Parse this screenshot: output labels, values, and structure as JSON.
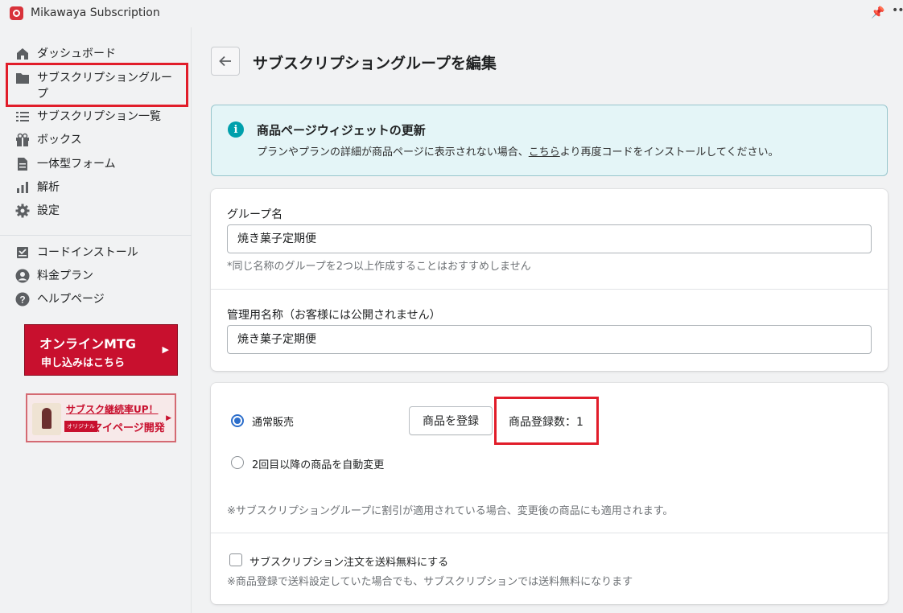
{
  "window": {
    "title": "Mikawaya Subscription"
  },
  "sidebar": {
    "items": [
      {
        "label": "ダッシュボード",
        "icon": "home-icon"
      },
      {
        "label": "サブスクリプショングループ",
        "icon": "folder-icon"
      },
      {
        "label": "サブスクリプション一覧",
        "icon": "list-icon"
      },
      {
        "label": "ボックス",
        "icon": "gift-icon"
      },
      {
        "label": "一体型フォーム",
        "icon": "document-icon"
      },
      {
        "label": "解析",
        "icon": "bar-chart-icon"
      },
      {
        "label": "設定",
        "icon": "gear-icon"
      }
    ],
    "secondary_items": [
      {
        "label": "コードインストール",
        "icon": "install-icon"
      },
      {
        "label": "料金プラン",
        "icon": "user-icon"
      },
      {
        "label": "ヘルプページ",
        "icon": "help-icon"
      }
    ],
    "banner_mtg": {
      "line1": "オンラインMTG",
      "line2": "申し込みはこちら"
    },
    "banner_mypage": {
      "line1": "サブスク継続率UP！",
      "tag": "オリジナル",
      "line2": "マイページ開発"
    }
  },
  "page": {
    "title": "サブスクリプショングループを編集"
  },
  "info_banner": {
    "title": "商品ページウィジェットの更新",
    "body_before": "プランやプランの詳細が商品ページに表示されない場合、",
    "link": "こちら",
    "body_after": "より再度コードをインストールしてください。"
  },
  "group_form": {
    "name_label": "グループ名",
    "name_value": "焼き菓子定期便",
    "name_help": "*同じ名称のグループを2つ以上作成することはおすすめしません",
    "admin_label": "管理用名称（お客様には公開されません）",
    "admin_value": "焼き菓子定期便"
  },
  "sales": {
    "option_normal": "通常販売",
    "option_auto": "2回目以降の商品を自動変更",
    "register_button": "商品を登録",
    "registered_count": "商品登録数：1",
    "discount_note": "※サブスクリプショングループに割引が適用されている場合、変更後の商品にも適用されます。",
    "free_shipping_label": "サブスクリプション注文を送料無料にする",
    "free_shipping_note": "※商品登録で送料設定していた場合でも、サブスクリプションでは送料無料になります"
  },
  "colors": {
    "accent": "#2c6ecb",
    "highlight": "#e11d2a",
    "brand": "#c8102e",
    "info_bg": "#e4f5f7"
  }
}
